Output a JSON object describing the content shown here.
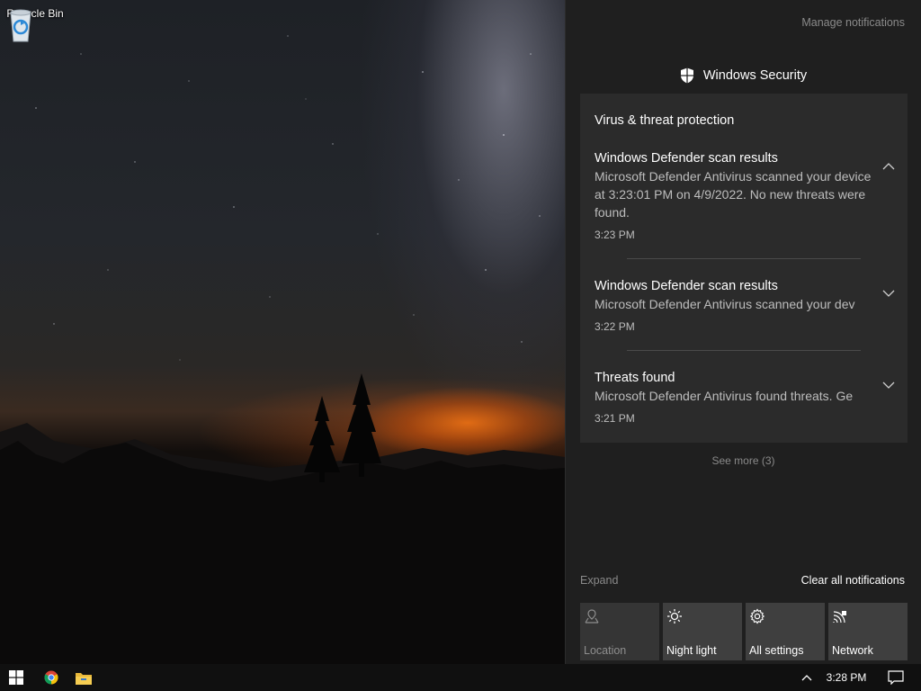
{
  "desktop": {
    "icons": [
      {
        "label": "Recycle Bin",
        "icon": "recycle-bin-icon"
      }
    ]
  },
  "action_center": {
    "manage_link": "Manage notifications",
    "group": {
      "app_name": "Windows Security",
      "icon": "shield-icon",
      "section_title": "Virus & threat protection",
      "notifications": [
        {
          "title": "Windows Defender scan results",
          "body": "Microsoft Defender Antivirus scanned your device at 3:23:01 PM on 4/9/2022. No new threats were found.",
          "time": "3:23 PM",
          "expanded": true
        },
        {
          "title": "Windows Defender scan results",
          "body": "Microsoft Defender Antivirus scanned your dev",
          "time": "3:22 PM",
          "expanded": false
        },
        {
          "title": "Threats found",
          "body": "Microsoft Defender Antivirus found threats. Ge",
          "time": "3:21 PM",
          "expanded": false
        }
      ],
      "see_more": "See more (3)"
    },
    "expand_link": "Expand",
    "clear_all": "Clear all notifications",
    "quick_actions": [
      {
        "label": "Location",
        "icon": "location-icon",
        "enabled": false
      },
      {
        "label": "Night light",
        "icon": "brightness-icon",
        "enabled": true
      },
      {
        "label": "All settings",
        "icon": "gear-icon",
        "enabled": true
      },
      {
        "label": "Network",
        "icon": "network-icon",
        "enabled": true
      }
    ]
  },
  "taskbar": {
    "pinned": [
      {
        "name": "start-button",
        "icon": "windows-logo-icon"
      },
      {
        "name": "chrome",
        "icon": "chrome-icon"
      },
      {
        "name": "file-explorer",
        "icon": "folder-icon"
      }
    ],
    "clock": "3:28 PM"
  },
  "colors": {
    "action_center_bg": "#1f1f1f",
    "card_bg": "#2b2b2b",
    "tile_bg": "#3f3f3f",
    "taskbar_bg": "#101010"
  }
}
